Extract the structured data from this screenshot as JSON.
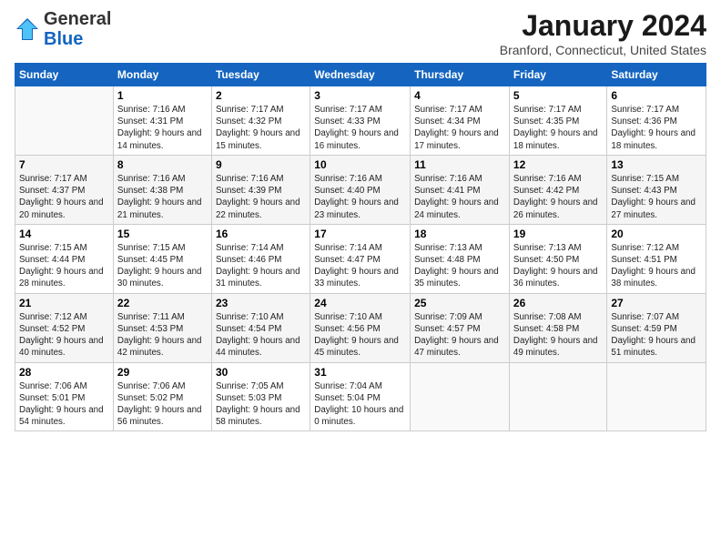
{
  "header": {
    "logo_general": "General",
    "logo_blue": "Blue",
    "month_title": "January 2024",
    "location": "Branford, Connecticut, United States"
  },
  "days_of_week": [
    "Sunday",
    "Monday",
    "Tuesday",
    "Wednesday",
    "Thursday",
    "Friday",
    "Saturday"
  ],
  "weeks": [
    [
      {
        "day": "",
        "sunrise": "",
        "sunset": "",
        "daylight": ""
      },
      {
        "day": "1",
        "sunrise": "Sunrise: 7:16 AM",
        "sunset": "Sunset: 4:31 PM",
        "daylight": "Daylight: 9 hours and 14 minutes."
      },
      {
        "day": "2",
        "sunrise": "Sunrise: 7:17 AM",
        "sunset": "Sunset: 4:32 PM",
        "daylight": "Daylight: 9 hours and 15 minutes."
      },
      {
        "day": "3",
        "sunrise": "Sunrise: 7:17 AM",
        "sunset": "Sunset: 4:33 PM",
        "daylight": "Daylight: 9 hours and 16 minutes."
      },
      {
        "day": "4",
        "sunrise": "Sunrise: 7:17 AM",
        "sunset": "Sunset: 4:34 PM",
        "daylight": "Daylight: 9 hours and 17 minutes."
      },
      {
        "day": "5",
        "sunrise": "Sunrise: 7:17 AM",
        "sunset": "Sunset: 4:35 PM",
        "daylight": "Daylight: 9 hours and 18 minutes."
      },
      {
        "day": "6",
        "sunrise": "Sunrise: 7:17 AM",
        "sunset": "Sunset: 4:36 PM",
        "daylight": "Daylight: 9 hours and 18 minutes."
      }
    ],
    [
      {
        "day": "7",
        "sunrise": "Sunrise: 7:17 AM",
        "sunset": "Sunset: 4:37 PM",
        "daylight": "Daylight: 9 hours and 20 minutes."
      },
      {
        "day": "8",
        "sunrise": "Sunrise: 7:16 AM",
        "sunset": "Sunset: 4:38 PM",
        "daylight": "Daylight: 9 hours and 21 minutes."
      },
      {
        "day": "9",
        "sunrise": "Sunrise: 7:16 AM",
        "sunset": "Sunset: 4:39 PM",
        "daylight": "Daylight: 9 hours and 22 minutes."
      },
      {
        "day": "10",
        "sunrise": "Sunrise: 7:16 AM",
        "sunset": "Sunset: 4:40 PM",
        "daylight": "Daylight: 9 hours and 23 minutes."
      },
      {
        "day": "11",
        "sunrise": "Sunrise: 7:16 AM",
        "sunset": "Sunset: 4:41 PM",
        "daylight": "Daylight: 9 hours and 24 minutes."
      },
      {
        "day": "12",
        "sunrise": "Sunrise: 7:16 AM",
        "sunset": "Sunset: 4:42 PM",
        "daylight": "Daylight: 9 hours and 26 minutes."
      },
      {
        "day": "13",
        "sunrise": "Sunrise: 7:15 AM",
        "sunset": "Sunset: 4:43 PM",
        "daylight": "Daylight: 9 hours and 27 minutes."
      }
    ],
    [
      {
        "day": "14",
        "sunrise": "Sunrise: 7:15 AM",
        "sunset": "Sunset: 4:44 PM",
        "daylight": "Daylight: 9 hours and 28 minutes."
      },
      {
        "day": "15",
        "sunrise": "Sunrise: 7:15 AM",
        "sunset": "Sunset: 4:45 PM",
        "daylight": "Daylight: 9 hours and 30 minutes."
      },
      {
        "day": "16",
        "sunrise": "Sunrise: 7:14 AM",
        "sunset": "Sunset: 4:46 PM",
        "daylight": "Daylight: 9 hours and 31 minutes."
      },
      {
        "day": "17",
        "sunrise": "Sunrise: 7:14 AM",
        "sunset": "Sunset: 4:47 PM",
        "daylight": "Daylight: 9 hours and 33 minutes."
      },
      {
        "day": "18",
        "sunrise": "Sunrise: 7:13 AM",
        "sunset": "Sunset: 4:48 PM",
        "daylight": "Daylight: 9 hours and 35 minutes."
      },
      {
        "day": "19",
        "sunrise": "Sunrise: 7:13 AM",
        "sunset": "Sunset: 4:50 PM",
        "daylight": "Daylight: 9 hours and 36 minutes."
      },
      {
        "day": "20",
        "sunrise": "Sunrise: 7:12 AM",
        "sunset": "Sunset: 4:51 PM",
        "daylight": "Daylight: 9 hours and 38 minutes."
      }
    ],
    [
      {
        "day": "21",
        "sunrise": "Sunrise: 7:12 AM",
        "sunset": "Sunset: 4:52 PM",
        "daylight": "Daylight: 9 hours and 40 minutes."
      },
      {
        "day": "22",
        "sunrise": "Sunrise: 7:11 AM",
        "sunset": "Sunset: 4:53 PM",
        "daylight": "Daylight: 9 hours and 42 minutes."
      },
      {
        "day": "23",
        "sunrise": "Sunrise: 7:10 AM",
        "sunset": "Sunset: 4:54 PM",
        "daylight": "Daylight: 9 hours and 44 minutes."
      },
      {
        "day": "24",
        "sunrise": "Sunrise: 7:10 AM",
        "sunset": "Sunset: 4:56 PM",
        "daylight": "Daylight: 9 hours and 45 minutes."
      },
      {
        "day": "25",
        "sunrise": "Sunrise: 7:09 AM",
        "sunset": "Sunset: 4:57 PM",
        "daylight": "Daylight: 9 hours and 47 minutes."
      },
      {
        "day": "26",
        "sunrise": "Sunrise: 7:08 AM",
        "sunset": "Sunset: 4:58 PM",
        "daylight": "Daylight: 9 hours and 49 minutes."
      },
      {
        "day": "27",
        "sunrise": "Sunrise: 7:07 AM",
        "sunset": "Sunset: 4:59 PM",
        "daylight": "Daylight: 9 hours and 51 minutes."
      }
    ],
    [
      {
        "day": "28",
        "sunrise": "Sunrise: 7:06 AM",
        "sunset": "Sunset: 5:01 PM",
        "daylight": "Daylight: 9 hours and 54 minutes."
      },
      {
        "day": "29",
        "sunrise": "Sunrise: 7:06 AM",
        "sunset": "Sunset: 5:02 PM",
        "daylight": "Daylight: 9 hours and 56 minutes."
      },
      {
        "day": "30",
        "sunrise": "Sunrise: 7:05 AM",
        "sunset": "Sunset: 5:03 PM",
        "daylight": "Daylight: 9 hours and 58 minutes."
      },
      {
        "day": "31",
        "sunrise": "Sunrise: 7:04 AM",
        "sunset": "Sunset: 5:04 PM",
        "daylight": "Daylight: 10 hours and 0 minutes."
      },
      {
        "day": "",
        "sunrise": "",
        "sunset": "",
        "daylight": ""
      },
      {
        "day": "",
        "sunrise": "",
        "sunset": "",
        "daylight": ""
      },
      {
        "day": "",
        "sunrise": "",
        "sunset": "",
        "daylight": ""
      }
    ]
  ]
}
